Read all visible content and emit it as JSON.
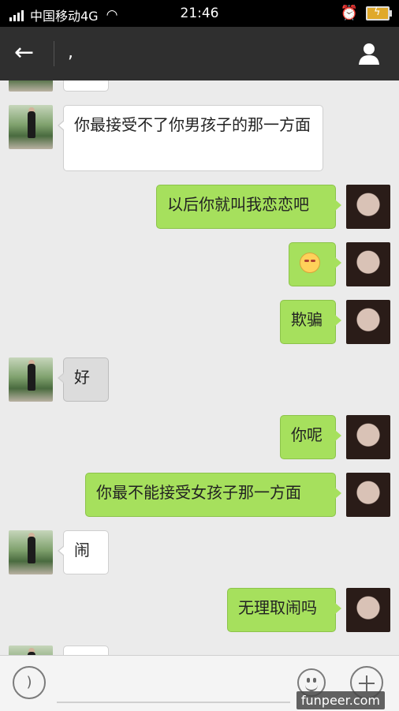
{
  "status_bar": {
    "carrier": "中国移动4G",
    "time": "21:46",
    "icons": [
      "signal-icon",
      "wifi-icon",
      "alarm-clock-icon",
      "battery-charging-icon"
    ]
  },
  "header": {
    "title": ",",
    "back_icon": "arrow-left-icon",
    "profile_icon": "person-icon"
  },
  "messages": [
    {
      "side": "left",
      "style": "white",
      "text": "你最接受不了你男孩子的那一方面"
    },
    {
      "side": "right",
      "style": "green",
      "text": "以后你就叫我恋恋吧"
    },
    {
      "side": "right",
      "style": "green",
      "text": "",
      "icon": "emoji-icon"
    },
    {
      "side": "right",
      "style": "green",
      "text": "欺骗"
    },
    {
      "side": "left",
      "style": "gray",
      "text": "好"
    },
    {
      "side": "right",
      "style": "green",
      "text": "你呢"
    },
    {
      "side": "right",
      "style": "green",
      "text": "你最不能接受女孩子那一方面"
    },
    {
      "side": "left",
      "style": "white",
      "text": "闹"
    },
    {
      "side": "right",
      "style": "green",
      "text": "无理取闹吗"
    }
  ],
  "input_bar": {
    "voice_icon": "voice-icon",
    "emoji_icon": "smile-icon",
    "plus_icon": "plus-icon"
  },
  "watermark": "funpeer.com"
}
